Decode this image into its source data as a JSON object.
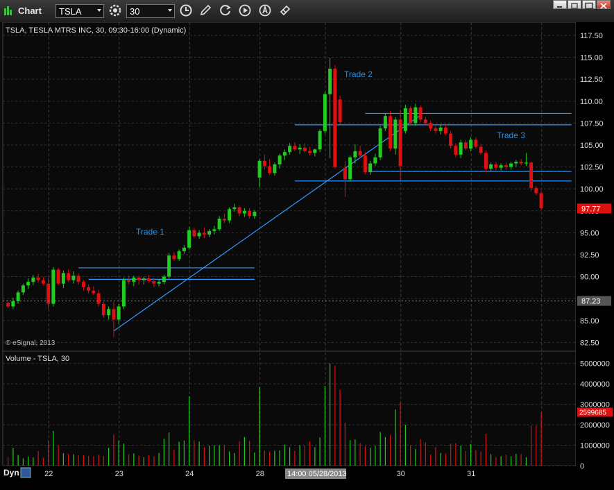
{
  "window": {
    "title": "Chart",
    "symbol": "TSLA",
    "interval": "30"
  },
  "toolbar": {
    "icons": [
      "chart-settings-icon",
      "clock-icon",
      "pencil-icon",
      "refresh-icon",
      "play-icon",
      "alert-icon",
      "tools-icon"
    ]
  },
  "price_pane": {
    "header": "TSLA, TESLA MTRS INC, 30, 09:30-16:00 (Dynamic)",
    "copyright": "© eSignal, 2013",
    "last_price_label": "97.77",
    "crosshair_label": "87.23",
    "annotations": [
      "Trade 1",
      "Trade 2",
      "Trade 3"
    ]
  },
  "volume_pane": {
    "header": "Volume - TSLA, 30",
    "last_volume_label": "2599685"
  },
  "footer": {
    "mode": "Dyn",
    "cursor_time": "14:00 05/28/2013"
  },
  "colors": {
    "up": "#22cc22",
    "down": "#dd1111",
    "trendline": "#3399ff",
    "annotation": "#2b8fe0",
    "last_price_bg": "#dd1111"
  },
  "chart_data": [
    {
      "type": "candlestick",
      "title": "TSLA, TESLA MTRS INC, 30, 09:30-16:00 (Dynamic)",
      "x_tick_labels": [
        "22",
        "23",
        "24",
        "28",
        "30",
        "31"
      ],
      "ylim": [
        81.5,
        119
      ],
      "y_ticks": [
        82.5,
        85.0,
        87.5,
        90.0,
        92.5,
        95.0,
        97.5,
        100.0,
        102.5,
        105.0,
        107.5,
        110.0,
        112.5,
        115.0,
        117.5
      ],
      "grid": true,
      "candles": [
        [
          87.0,
          87.3,
          86.4,
          86.6
        ],
        [
          86.6,
          87.6,
          86.3,
          87.2
        ],
        [
          87.2,
          88.4,
          86.9,
          88.2
        ],
        [
          88.2,
          89.2,
          87.9,
          89.0
        ],
        [
          89.0,
          89.8,
          88.6,
          89.4
        ],
        [
          89.4,
          90.2,
          89.0,
          89.9
        ],
        [
          89.9,
          90.3,
          89.3,
          89.6
        ],
        [
          89.6,
          90.0,
          89.0,
          89.2
        ],
        [
          89.2,
          89.9,
          86.3,
          86.9
        ],
        [
          86.9,
          91.1,
          86.6,
          90.8
        ],
        [
          90.8,
          91.0,
          89.0,
          89.2
        ],
        [
          89.2,
          90.7,
          88.7,
          90.4
        ],
        [
          90.4,
          90.8,
          89.4,
          89.6
        ],
        [
          89.6,
          90.6,
          89.2,
          90.1
        ],
        [
          90.1,
          90.4,
          89.1,
          89.4
        ],
        [
          89.4,
          89.6,
          88.4,
          88.8
        ],
        [
          88.8,
          89.1,
          88.1,
          88.4
        ],
        [
          88.4,
          88.9,
          87.9,
          88.1
        ],
        [
          88.1,
          88.5,
          86.6,
          86.9
        ],
        [
          86.9,
          87.1,
          85.3,
          85.6
        ],
        [
          85.6,
          86.6,
          85.1,
          86.3
        ],
        [
          86.3,
          87.1,
          83.1,
          85.1
        ],
        [
          85.1,
          86.9,
          84.6,
          86.6
        ],
        [
          86.6,
          89.9,
          86.3,
          89.6
        ],
        [
          89.6,
          90.1,
          89.1,
          89.4
        ],
        [
          89.4,
          90.1,
          88.9,
          89.9
        ],
        [
          89.9,
          90.1,
          89.1,
          89.6
        ],
        [
          89.6,
          90.0,
          89.1,
          89.8
        ],
        [
          89.8,
          90.2,
          89.3,
          89.5
        ],
        [
          89.5,
          89.8,
          88.8,
          89.2
        ],
        [
          89.2,
          89.7,
          88.9,
          89.4
        ],
        [
          89.4,
          90.2,
          89.1,
          90.0
        ],
        [
          90.0,
          92.7,
          89.8,
          92.4
        ],
        [
          92.4,
          92.8,
          91.8,
          92.0
        ],
        [
          92.0,
          93.1,
          91.8,
          92.9
        ],
        [
          92.9,
          93.6,
          92.6,
          93.3
        ],
        [
          93.3,
          95.7,
          93.1,
          95.3
        ],
        [
          95.3,
          95.6,
          94.4,
          94.6
        ],
        [
          94.6,
          95.3,
          94.3,
          95.0
        ],
        [
          95.0,
          95.6,
          94.4,
          94.8
        ],
        [
          94.8,
          95.4,
          94.5,
          95.2
        ],
        [
          95.2,
          95.8,
          94.8,
          95.4
        ],
        [
          95.4,
          96.9,
          95.2,
          96.6
        ],
        [
          96.6,
          97.2,
          96.1,
          96.4
        ],
        [
          96.4,
          97.9,
          96.1,
          97.7
        ],
        [
          97.7,
          98.3,
          97.4,
          97.9
        ],
        [
          97.9,
          98.1,
          96.9,
          97.2
        ],
        [
          97.2,
          97.8,
          96.8,
          97.5
        ],
        [
          97.5,
          97.8,
          96.6,
          96.9
        ],
        [
          96.9,
          97.6,
          96.6,
          97.4
        ],
        [
          101.3,
          103.4,
          100.2,
          103.2
        ],
        [
          103.2,
          103.9,
          102.2,
          102.6
        ],
        [
          102.6,
          103.4,
          101.6,
          101.8
        ],
        [
          101.8,
          103.0,
          101.5,
          102.8
        ],
        [
          102.8,
          104.0,
          102.3,
          103.8
        ],
        [
          103.8,
          104.5,
          103.3,
          104.2
        ],
        [
          104.2,
          105.2,
          103.9,
          104.9
        ],
        [
          104.9,
          105.3,
          104.3,
          104.5
        ],
        [
          104.5,
          105.1,
          104.0,
          104.7
        ],
        [
          104.7,
          105.2,
          104.1,
          104.3
        ],
        [
          104.3,
          104.8,
          103.8,
          104.1
        ],
        [
          104.1,
          104.6,
          103.7,
          104.5
        ],
        [
          104.5,
          106.8,
          104.2,
          106.6
        ],
        [
          106.6,
          111.1,
          106.3,
          110.8
        ],
        [
          110.8,
          114.9,
          103.5,
          113.7
        ],
        [
          113.7,
          114.1,
          102.3,
          102.5
        ],
        [
          110.2,
          110.6,
          107.4,
          107.6
        ],
        [
          102.4,
          103.2,
          99.1,
          101.1
        ],
        [
          101.1,
          103.8,
          100.8,
          103.6
        ],
        [
          103.6,
          105.1,
          102.9,
          104.3
        ],
        [
          104.3,
          104.9,
          103.5,
          103.8
        ],
        [
          103.8,
          104.2,
          101.7,
          101.9
        ],
        [
          101.9,
          103.2,
          101.6,
          102.9
        ],
        [
          102.9,
          104.0,
          102.6,
          103.6
        ],
        [
          103.6,
          107.2,
          103.3,
          106.9
        ],
        [
          106.9,
          108.6,
          106.6,
          108.3
        ],
        [
          108.3,
          108.9,
          104.3,
          104.6
        ],
        [
          104.6,
          108.2,
          103.9,
          107.9
        ],
        [
          107.9,
          109.0,
          101.0,
          102.6
        ],
        [
          106.6,
          109.6,
          106.3,
          109.2
        ],
        [
          109.2,
          109.4,
          107.2,
          107.5
        ],
        [
          107.5,
          109.7,
          107.2,
          109.3
        ],
        [
          109.3,
          109.5,
          107.6,
          107.9
        ],
        [
          107.9,
          108.2,
          107.2,
          107.5
        ],
        [
          107.5,
          107.8,
          106.6,
          106.9
        ],
        [
          106.9,
          107.2,
          106.3,
          106.6
        ],
        [
          106.6,
          107.3,
          106.2,
          107.0
        ],
        [
          107.0,
          107.3,
          106.1,
          106.3
        ],
        [
          106.3,
          106.6,
          104.6,
          104.9
        ],
        [
          104.9,
          105.2,
          103.6,
          103.9
        ],
        [
          103.9,
          105.6,
          103.5,
          105.3
        ],
        [
          105.3,
          105.6,
          104.4,
          104.6
        ],
        [
          104.6,
          105.9,
          104.3,
          105.6
        ],
        [
          105.6,
          105.9,
          104.6,
          104.8
        ],
        [
          104.8,
          105.1,
          103.9,
          104.1
        ],
        [
          104.1,
          104.4,
          101.9,
          102.3
        ],
        [
          102.3,
          103.0,
          102.0,
          102.8
        ],
        [
          102.8,
          103.1,
          102.1,
          102.4
        ],
        [
          102.4,
          102.9,
          102.1,
          102.7
        ],
        [
          102.7,
          103.0,
          102.2,
          102.5
        ],
        [
          102.5,
          103.1,
          102.2,
          102.9
        ],
        [
          102.9,
          103.3,
          102.5,
          103.1
        ],
        [
          103.1,
          103.4,
          102.7,
          102.9
        ],
        [
          102.9,
          104.1,
          102.6,
          103.0
        ],
        [
          103.0,
          103.1,
          99.8,
          100.1
        ],
        [
          100.1,
          100.3,
          99.3,
          99.5
        ],
        [
          99.5,
          99.8,
          97.6,
          97.8
        ]
      ],
      "horizontal_lines": [
        {
          "from": 14,
          "to": 49,
          "price": 91.0
        },
        {
          "from": 16,
          "to": 49,
          "price": 89.7
        },
        {
          "from": 57,
          "to": 112,
          "price": 107.3
        },
        {
          "from": 71,
          "to": 112,
          "price": 108.6
        },
        {
          "from": 57,
          "to": 112,
          "price": 100.9
        },
        {
          "from": 72,
          "to": 112,
          "price": 102.0
        }
      ],
      "trend_lines": [
        {
          "x0": 21,
          "p0": 83.8,
          "x1": 82,
          "p1": 108.4
        }
      ],
      "last_price": 97.77,
      "crosshair_price": 87.23
    },
    {
      "type": "bar",
      "title": "Volume - TSLA, 30",
      "ylim": [
        0,
        5600000
      ],
      "y_ticks": [
        0,
        1000000,
        2000000,
        3000000,
        4000000,
        5000000
      ],
      "values": [
        420000,
        860000,
        520000,
        360000,
        440000,
        400000,
        720000,
        400000,
        1200000,
        1700000,
        980000,
        610000,
        580000,
        560000,
        520000,
        520000,
        480000,
        450000,
        530000,
        480000,
        880000,
        1520000,
        1230000,
        1080000,
        560000,
        600000,
        480000,
        420000,
        520000,
        440000,
        620000,
        1320000,
        1620000,
        780000,
        1170000,
        1230000,
        3400000,
        1240000,
        1180000,
        900000,
        980000,
        1000000,
        1000000,
        1020000,
        700000,
        620000,
        1200000,
        1400000,
        1210000,
        640000,
        3850000,
        740000,
        690000,
        730000,
        750000,
        1030000,
        900000,
        730000,
        1000000,
        990000,
        1200000,
        900000,
        1380000,
        3900000,
        5000000,
        4900000,
        3700000,
        2100000,
        1250000,
        1280000,
        1100000,
        960000,
        880000,
        980000,
        1650000,
        1400000,
        1500000,
        2750000,
        3100000,
        2000000,
        1000000,
        820000,
        1300000,
        1150000,
        550000,
        900000,
        620000,
        600000,
        1080000,
        1100000,
        980000,
        720000,
        1060000,
        760000,
        700000,
        1560000,
        570000,
        400000,
        460000,
        540000,
        470000,
        580000,
        570000,
        410000,
        1960000,
        1950000,
        2600000
      ],
      "last_value": 2599685
    }
  ]
}
